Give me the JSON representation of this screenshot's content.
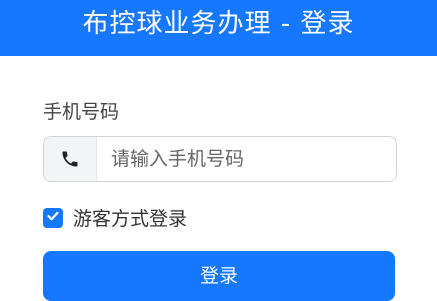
{
  "header": {
    "title": "布控球业务办理 - 登录"
  },
  "form": {
    "phone_label": "手机号码",
    "phone_prefix_icon": "phone-icon",
    "phone_placeholder": "请输入手机号码",
    "phone_value": "",
    "guest_checked": true,
    "guest_label": "游客方式登录",
    "login_label": "登录"
  },
  "colors": {
    "primary": "#1677ff",
    "text": "#333333",
    "border": "#cfd4da",
    "prefix_bg": "#f3f4f6"
  }
}
